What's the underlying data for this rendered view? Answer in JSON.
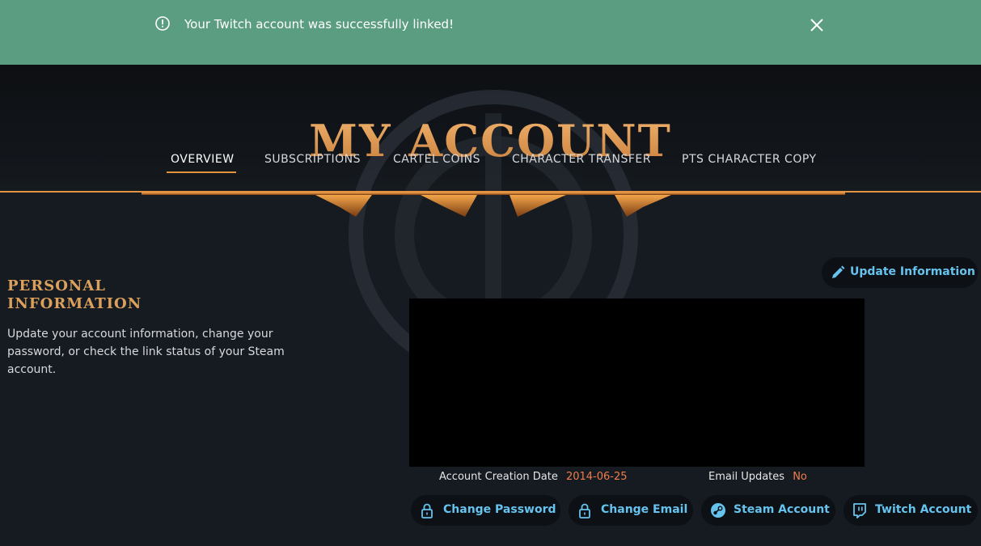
{
  "banner": {
    "message": "Your Twitch account was successfully linked!",
    "icon": "alert-circle-icon",
    "close_icon": "close-icon",
    "color": "#5b9d81"
  },
  "header": {
    "title": "MY ACCOUNT",
    "tabs": [
      {
        "label": "OVERVIEW",
        "active": true
      },
      {
        "label": "SUBSCRIPTIONS",
        "active": false
      },
      {
        "label": "CARTEL COINS",
        "active": false
      },
      {
        "label": "CHARACTER TRANSFER",
        "active": false
      },
      {
        "label": "PTS CHARACTER COPY",
        "active": false
      }
    ]
  },
  "personal_info": {
    "title_line1": "PERSONAL",
    "title_line2": "INFORMATION",
    "description": "Update your account information, change your password, or check the link status of your Steam account.",
    "update_button": "Update Information",
    "account_creation_label": "Account Creation Date",
    "account_creation_value": "2014-06-25",
    "email_updates_label": "Email Updates",
    "email_updates_value": "No"
  },
  "actions": {
    "change_password": "Change Password",
    "change_email": "Change Email",
    "steam_account": "Steam Account",
    "twitch_account": "Twitch Account"
  },
  "colors": {
    "accent_gold": "#d79a57",
    "link_blue": "#66c3ee",
    "value_orange": "#ef7d4d"
  }
}
